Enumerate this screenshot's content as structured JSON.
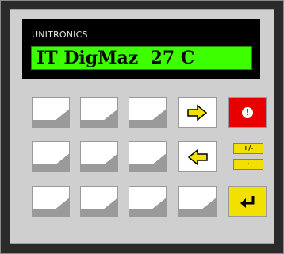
{
  "device": {
    "brand": "UNITRONICS",
    "lcd_text": "IT DigMaz  27 C",
    "colors": {
      "lcd": "#3dff00",
      "alarm": "#e80000",
      "function_key": "#f2e100",
      "panel": "#cfcfcf"
    }
  },
  "keys": {
    "blank_count": 10,
    "right_arrow_icon": "right-arrow-icon",
    "left_arrow_icon": "left-arrow-icon",
    "alarm_icon": "exclamation-icon",
    "alarm_symbol": "!",
    "plus_minus_label": "+/-",
    "dot_label": "·",
    "enter_icon": "enter-icon"
  }
}
